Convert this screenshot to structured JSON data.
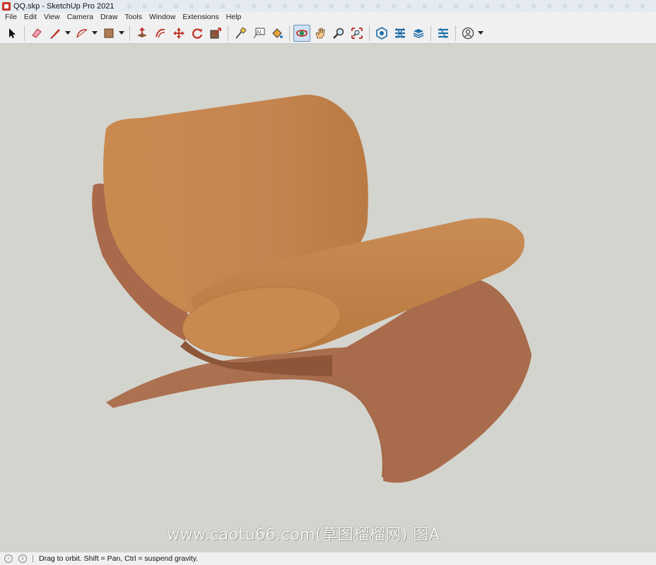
{
  "window": {
    "title": "QQ.skp - SketchUp Pro 2021"
  },
  "menu": {
    "items": [
      "File",
      "Edit",
      "View",
      "Camera",
      "Draw",
      "Tools",
      "Window",
      "Extensions",
      "Help"
    ]
  },
  "toolbar": {
    "tools": [
      {
        "name": "select-icon",
        "active": false
      },
      {
        "name": "eraser-icon",
        "active": false
      },
      {
        "name": "line-pencil-icon",
        "active": false,
        "dropdown": true
      },
      {
        "name": "arc-icon",
        "active": false,
        "dropdown": true
      },
      {
        "name": "rectangle-icon",
        "active": false,
        "dropdown": true
      },
      {
        "name": "push-pull-icon",
        "active": false
      },
      {
        "name": "offset-icon",
        "active": false
      },
      {
        "name": "move-icon",
        "active": false
      },
      {
        "name": "rotate-icon",
        "active": false
      },
      {
        "name": "scale-icon",
        "active": false
      },
      {
        "name": "tape-measure-icon",
        "active": false
      },
      {
        "name": "text-icon",
        "active": false
      },
      {
        "name": "paint-bucket-icon",
        "active": false
      },
      {
        "name": "orbit-icon",
        "active": true
      },
      {
        "name": "pan-icon",
        "active": false
      },
      {
        "name": "zoom-icon",
        "active": false
      },
      {
        "name": "zoom-extents-icon",
        "active": false
      },
      {
        "name": "warehouse-icon",
        "active": false
      },
      {
        "name": "extension-warehouse-icon",
        "active": false
      },
      {
        "name": "layout-icon",
        "active": false
      },
      {
        "name": "extension-manager-icon",
        "active": false
      },
      {
        "name": "account-icon",
        "active": false,
        "dropdown": true
      }
    ],
    "text_tool_label": "A1"
  },
  "colors": {
    "viewport_bg": "#d4d4ce",
    "cushion": "#c98a4f",
    "frame": "#a86a4a",
    "active_tool_bg": "#cfe1f3"
  },
  "watermark": {
    "text": "www.caotu66.com(草图榴榴网) 图A"
  },
  "status": {
    "message": "Drag to orbit. Shift = Pan, Ctrl = suspend gravity."
  }
}
